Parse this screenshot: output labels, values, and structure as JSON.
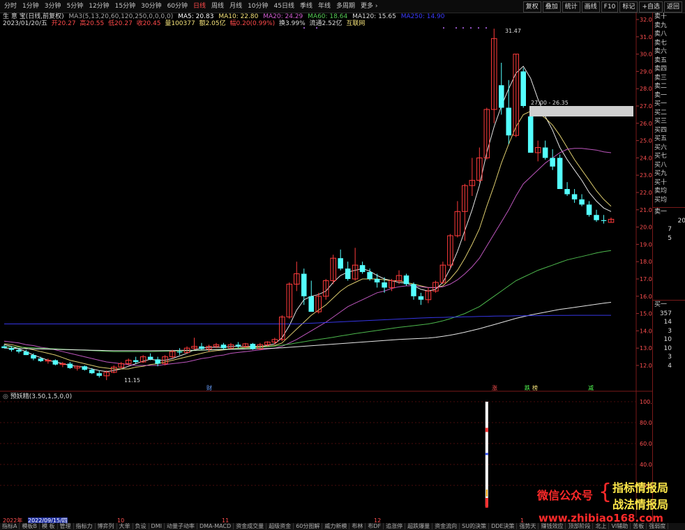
{
  "toolbar": {
    "periods": [
      "分时",
      "1分钟",
      "3分钟",
      "5分钟",
      "12分钟",
      "15分钟",
      "30分钟",
      "60分钟",
      "日线",
      "周线",
      "月线",
      "10分钟",
      "45日线",
      "季线",
      "年线",
      "多周期",
      "更多 ›"
    ],
    "active_period": "日线",
    "right_buttons": [
      "复权",
      "叠加",
      "统计",
      "画线",
      "F10",
      "标记",
      "+自选",
      "返回"
    ]
  },
  "info": {
    "line1_name": "生 意 宝(日线,前复权)",
    "line1_ma_params": "MA3(5,13,20,60,120,250,0,0,0,0)",
    "ma5": "MA5: 20.83",
    "ma10": "MA10: 22.80",
    "ma20": "MA20: 24.29",
    "ma60": "MA60: 18.64",
    "ma120": "MA120: 15.65",
    "ma250": "MA250: 14.90",
    "line2_date": "2023/01/20/五",
    "open": "开20.27",
    "high": "高20.55",
    "low": "低20.27",
    "close": "收20.45",
    "volume": "量100377",
    "amount": "额2.05亿",
    "change": "幅0.20(0.99%)",
    "turnover": "换3.99%",
    "float": "流通2.52亿",
    "sector": "互联网"
  },
  "price_axis": {
    "ticks": [
      "32.00",
      "31.00",
      "30.00",
      "29.00",
      "28.00",
      "27.00",
      "26.00",
      "25.00",
      "24.00",
      "23.00",
      "22.00",
      "21.00",
      "20.00",
      "19.00",
      "18.00",
      "17.00",
      "16.00",
      "15.00",
      "14.00",
      "13.00",
      "12.00"
    ]
  },
  "annotations": {
    "high_label": "31.47",
    "low_label": "11.15",
    "zone_label": "27.00 - 26.35",
    "event_markers": [
      "财",
      "涨",
      "跌",
      "榜",
      "减"
    ]
  },
  "sub_indicator": {
    "title": "预妖精(3.50,1,5,0,0)",
    "ticks": [
      "100.0",
      "80.00",
      "60.00",
      "40.00",
      "20.00"
    ]
  },
  "date_axis": {
    "labels": [
      "2022年",
      "2022/09/15/四",
      "10",
      "11",
      "12",
      "1"
    ]
  },
  "right_panel": {
    "sell_labels": [
      "卖十",
      "卖九",
      "卖八",
      "卖七",
      "卖六",
      "卖五",
      "卖四",
      "卖三",
      "卖二",
      "卖一"
    ],
    "buy_labels": [
      "买一",
      "买二",
      "买三",
      "买四",
      "买五",
      "买六",
      "买七",
      "买八",
      "买九",
      "买十"
    ],
    "avg_labels": [
      "卖均",
      "买均"
    ],
    "sell1_label": "卖一",
    "sell1_values": [
      "20",
      "7",
      "5"
    ],
    "buy1_label": "买一",
    "buy1_values": [
      "357",
      "14",
      "3",
      "10",
      "10",
      "3",
      "4"
    ],
    "buy1_side": "7"
  },
  "bottom_tabs": [
    "指标A",
    "模板B",
    "模 板",
    "管理",
    "指标力",
    "博弈列",
    "大单",
    "负设",
    "DMI",
    "动量子动率",
    "DMA-MACD",
    "资金成交量",
    "超级资金",
    "60分图解",
    "威力新模",
    "布林",
    "布DF",
    "追涨停",
    "超跌爆量",
    "资金流向",
    "SU的決策",
    "DDE決策",
    "强势天",
    "赚钱效应",
    "顶部阶段",
    "北上",
    "VI辅助",
    "苦板",
    "强弱度"
  ],
  "watermark": {
    "left": "微信公众号",
    "right1": "指标情报局",
    "right2": "战法情报局",
    "url": "www.zhibiao168.com"
  },
  "colors": {
    "up": "#ff3b3b",
    "down": "#54ffff",
    "ma5": "#ffffff",
    "ma10": "#f5e27a",
    "ma20": "#d35fd3",
    "ma60": "#55cc55",
    "ma120": "#ffffff",
    "ma250": "#3c3cff"
  },
  "chart_data": {
    "type": "candlestick",
    "y_range": [
      11.0,
      32.2
    ],
    "candles": [
      {
        "o": 13.1,
        "h": 13.2,
        "l": 13.0,
        "c": 13.0
      },
      {
        "o": 13.0,
        "h": 13.1,
        "l": 12.8,
        "c": 12.9
      },
      {
        "o": 12.9,
        "h": 13.0,
        "l": 12.7,
        "c": 12.8
      },
      {
        "o": 12.8,
        "h": 12.9,
        "l": 12.6,
        "c": 12.6
      },
      {
        "o": 12.6,
        "h": 12.7,
        "l": 12.3,
        "c": 12.4
      },
      {
        "o": 12.4,
        "h": 12.5,
        "l": 12.2,
        "c": 12.25
      },
      {
        "o": 12.25,
        "h": 12.4,
        "l": 12.1,
        "c": 12.3
      },
      {
        "o": 12.3,
        "h": 12.35,
        "l": 12.0,
        "c": 12.05
      },
      {
        "o": 12.05,
        "h": 12.2,
        "l": 11.9,
        "c": 12.1
      },
      {
        "o": 12.1,
        "h": 12.2,
        "l": 11.8,
        "c": 11.85
      },
      {
        "o": 11.85,
        "h": 12.0,
        "l": 11.7,
        "c": 11.95
      },
      {
        "o": 11.95,
        "h": 12.0,
        "l": 11.7,
        "c": 11.75
      },
      {
        "o": 11.75,
        "h": 11.85,
        "l": 11.5,
        "c": 11.55
      },
      {
        "o": 11.55,
        "h": 11.7,
        "l": 11.3,
        "c": 11.4
      },
      {
        "o": 11.4,
        "h": 11.7,
        "l": 11.15,
        "c": 11.6
      },
      {
        "o": 11.6,
        "h": 12.0,
        "l": 11.55,
        "c": 11.9
      },
      {
        "o": 11.9,
        "h": 12.2,
        "l": 11.8,
        "c": 12.1
      },
      {
        "o": 12.1,
        "h": 12.4,
        "l": 12.0,
        "c": 12.3
      },
      {
        "o": 12.3,
        "h": 12.5,
        "l": 12.1,
        "c": 12.2
      },
      {
        "o": 12.2,
        "h": 12.6,
        "l": 12.15,
        "c": 12.5
      },
      {
        "o": 12.5,
        "h": 12.7,
        "l": 12.3,
        "c": 12.35
      },
      {
        "o": 12.35,
        "h": 12.5,
        "l": 11.95,
        "c": 12.1
      },
      {
        "o": 12.1,
        "h": 12.6,
        "l": 12.0,
        "c": 12.5
      },
      {
        "o": 12.5,
        "h": 12.9,
        "l": 12.4,
        "c": 12.8
      },
      {
        "o": 12.8,
        "h": 13.0,
        "l": 12.6,
        "c": 12.75
      },
      {
        "o": 12.75,
        "h": 13.1,
        "l": 12.7,
        "c": 13.0
      },
      {
        "o": 13.0,
        "h": 13.6,
        "l": 12.9,
        "c": 13.1
      },
      {
        "o": 13.1,
        "h": 13.3,
        "l": 12.9,
        "c": 12.95
      },
      {
        "o": 12.95,
        "h": 13.2,
        "l": 12.8,
        "c": 13.1
      },
      {
        "o": 13.1,
        "h": 13.3,
        "l": 13.0,
        "c": 13.2
      },
      {
        "o": 13.2,
        "h": 13.3,
        "l": 12.9,
        "c": 13.0
      },
      {
        "o": 13.0,
        "h": 13.3,
        "l": 12.95,
        "c": 13.2
      },
      {
        "o": 13.2,
        "h": 13.35,
        "l": 13.0,
        "c": 13.1
      },
      {
        "o": 13.1,
        "h": 13.3,
        "l": 13.0,
        "c": 13.25
      },
      {
        "o": 13.25,
        "h": 13.3,
        "l": 12.9,
        "c": 12.95
      },
      {
        "o": 12.95,
        "h": 13.3,
        "l": 12.9,
        "c": 13.2
      },
      {
        "o": 13.2,
        "h": 13.4,
        "l": 13.1,
        "c": 13.35
      },
      {
        "o": 13.35,
        "h": 13.6,
        "l": 13.2,
        "c": 13.5
      },
      {
        "o": 13.5,
        "h": 14.9,
        "l": 13.4,
        "c": 14.8
      },
      {
        "o": 14.8,
        "h": 16.8,
        "l": 14.7,
        "c": 16.7
      },
      {
        "o": 16.7,
        "h": 18.0,
        "l": 16.3,
        "c": 17.3
      },
      {
        "o": 17.3,
        "h": 17.6,
        "l": 15.5,
        "c": 16.0
      },
      {
        "o": 16.0,
        "h": 16.9,
        "l": 15.7,
        "c": 15.1
      },
      {
        "o": 15.1,
        "h": 16.2,
        "l": 15.0,
        "c": 16.0
      },
      {
        "o": 16.0,
        "h": 17.0,
        "l": 15.8,
        "c": 16.9
      },
      {
        "o": 16.9,
        "h": 18.4,
        "l": 16.7,
        "c": 18.2
      },
      {
        "o": 18.2,
        "h": 18.7,
        "l": 17.5,
        "c": 17.6
      },
      {
        "o": 17.6,
        "h": 18.0,
        "l": 16.9,
        "c": 17.0
      },
      {
        "o": 17.0,
        "h": 18.8,
        "l": 16.9,
        "c": 17.8
      },
      {
        "o": 17.8,
        "h": 18.0,
        "l": 17.3,
        "c": 17.4
      },
      {
        "o": 17.4,
        "h": 17.6,
        "l": 16.9,
        "c": 17.0
      },
      {
        "o": 17.0,
        "h": 17.3,
        "l": 16.5,
        "c": 16.8
      },
      {
        "o": 16.8,
        "h": 17.1,
        "l": 16.2,
        "c": 16.5
      },
      {
        "o": 16.5,
        "h": 17.0,
        "l": 16.3,
        "c": 16.9
      },
      {
        "o": 16.9,
        "h": 17.5,
        "l": 16.7,
        "c": 17.2
      },
      {
        "o": 17.2,
        "h": 17.3,
        "l": 16.6,
        "c": 16.7
      },
      {
        "o": 16.7,
        "h": 16.8,
        "l": 15.8,
        "c": 16.0
      },
      {
        "o": 16.0,
        "h": 16.2,
        "l": 15.5,
        "c": 15.8
      },
      {
        "o": 15.8,
        "h": 16.5,
        "l": 15.6,
        "c": 16.3
      },
      {
        "o": 16.3,
        "h": 16.9,
        "l": 16.2,
        "c": 16.8
      },
      {
        "o": 16.8,
        "h": 18.0,
        "l": 16.7,
        "c": 17.8
      },
      {
        "o": 17.8,
        "h": 19.6,
        "l": 17.6,
        "c": 19.5
      },
      {
        "o": 19.5,
        "h": 21.5,
        "l": 19.4,
        "c": 20.9
      },
      {
        "o": 20.9,
        "h": 22.5,
        "l": 19.2,
        "c": 22.4
      },
      {
        "o": 22.4,
        "h": 24.0,
        "l": 21.8,
        "c": 22.7
      },
      {
        "o": 22.7,
        "h": 24.6,
        "l": 22.6,
        "c": 24.0
      },
      {
        "o": 24.0,
        "h": 26.9,
        "l": 23.9,
        "c": 26.8
      },
      {
        "o": 26.8,
        "h": 31.47,
        "l": 26.0,
        "c": 30.9
      },
      {
        "o": 28.2,
        "h": 29.5,
        "l": 26.5,
        "c": 26.9
      },
      {
        "o": 26.9,
        "h": 28.5,
        "l": 24.8,
        "c": 25.3
      },
      {
        "o": 25.3,
        "h": 30.0,
        "l": 25.2,
        "c": 30.0
      },
      {
        "o": 29.0,
        "h": 29.2,
        "l": 26.9,
        "c": 27.0
      },
      {
        "o": 26.4,
        "h": 26.6,
        "l": 24.3,
        "c": 24.3
      },
      {
        "o": 24.3,
        "h": 25.0,
        "l": 23.8,
        "c": 24.6
      },
      {
        "o": 24.6,
        "h": 25.0,
        "l": 23.9,
        "c": 24.0
      },
      {
        "o": 24.0,
        "h": 24.5,
        "l": 23.3,
        "c": 23.5
      },
      {
        "o": 24.0,
        "h": 24.2,
        "l": 22.2,
        "c": 22.2
      },
      {
        "o": 22.2,
        "h": 22.6,
        "l": 21.8,
        "c": 21.9
      },
      {
        "o": 21.9,
        "h": 22.2,
        "l": 21.4,
        "c": 21.6
      },
      {
        "o": 21.6,
        "h": 21.9,
        "l": 21.2,
        "c": 21.3
      },
      {
        "o": 21.3,
        "h": 21.5,
        "l": 20.6,
        "c": 20.7
      },
      {
        "o": 20.7,
        "h": 21.0,
        "l": 20.3,
        "c": 20.4
      },
      {
        "o": 20.4,
        "h": 20.7,
        "l": 20.2,
        "c": 20.35
      },
      {
        "o": 20.27,
        "h": 20.55,
        "l": 20.27,
        "c": 20.45
      }
    ],
    "ma_series": [
      {
        "name": "MA5",
        "values": [
          13.2,
          13.1,
          12.95,
          12.8,
          12.6,
          12.45,
          12.3,
          12.2,
          12.1,
          12.0,
          11.95,
          11.9,
          11.8,
          11.7,
          11.65,
          11.7,
          11.8,
          11.95,
          12.1,
          12.25,
          12.35,
          12.3,
          12.3,
          12.4,
          12.55,
          12.7,
          12.9,
          13.0,
          13.05,
          13.05,
          13.05,
          13.1,
          13.1,
          13.1,
          13.1,
          13.1,
          13.15,
          13.25,
          13.6,
          14.3,
          15.2,
          15.8,
          16.0,
          16.1,
          16.3,
          16.8,
          17.2,
          17.4,
          17.5,
          17.6,
          17.45,
          17.2,
          17.0,
          16.9,
          16.8,
          16.75,
          16.6,
          16.4,
          16.3,
          16.4,
          16.8,
          17.6,
          18.6,
          19.8,
          21.0,
          22.4,
          24.3,
          25.8,
          27.0,
          28.0,
          28.9,
          29.3,
          28.6,
          27.4,
          26.4,
          25.6,
          24.6,
          23.9,
          23.3,
          22.7,
          22.0,
          21.5,
          21.1,
          20.9
        ]
      },
      {
        "name": "MA10",
        "values": [
          13.25,
          13.2,
          13.1,
          13.0,
          12.9,
          12.8,
          12.7,
          12.6,
          12.45,
          12.3,
          12.2,
          12.1,
          12.0,
          11.9,
          11.85,
          11.8,
          11.8,
          11.8,
          11.9,
          11.95,
          12.05,
          12.1,
          12.2,
          12.3,
          12.4,
          12.5,
          12.6,
          12.7,
          12.8,
          12.85,
          12.9,
          12.95,
          13.0,
          13.05,
          13.05,
          13.1,
          13.1,
          13.15,
          13.3,
          13.7,
          14.1,
          14.5,
          14.9,
          15.2,
          15.5,
          15.9,
          16.3,
          16.6,
          16.8,
          17.0,
          17.0,
          17.0,
          16.95,
          16.9,
          16.9,
          16.8,
          16.7,
          16.6,
          16.5,
          16.5,
          16.6,
          17.0,
          17.5,
          18.2,
          19.0,
          19.9,
          21.2,
          22.4,
          23.7,
          24.8,
          25.8,
          26.5,
          26.7,
          26.6,
          26.3,
          25.9,
          25.3,
          24.6,
          23.9,
          23.3,
          22.7,
          22.1,
          21.6,
          21.2
        ]
      },
      {
        "name": "MA20",
        "values": [
          13.4,
          13.35,
          13.3,
          13.2,
          13.15,
          13.05,
          13.0,
          12.9,
          12.8,
          12.7,
          12.6,
          12.5,
          12.4,
          12.3,
          12.2,
          12.15,
          12.1,
          12.05,
          12.0,
          12.0,
          12.0,
          12.0,
          12.05,
          12.1,
          12.15,
          12.2,
          12.3,
          12.4,
          12.45,
          12.55,
          12.6,
          12.7,
          12.75,
          12.8,
          12.85,
          12.9,
          12.95,
          13.0,
          13.1,
          13.3,
          13.5,
          13.75,
          14.0,
          14.25,
          14.5,
          14.8,
          15.1,
          15.4,
          15.6,
          15.8,
          16.0,
          16.2,
          16.3,
          16.45,
          16.55,
          16.6,
          16.6,
          16.55,
          16.5,
          16.5,
          16.55,
          16.7,
          16.95,
          17.3,
          17.7,
          18.2,
          18.9,
          19.6,
          20.3,
          21.0,
          21.8,
          22.5,
          22.9,
          23.3,
          23.7,
          24.0,
          24.3,
          24.5,
          24.55,
          24.55,
          24.5,
          24.45,
          24.35,
          24.3
        ]
      },
      {
        "name": "MA60",
        "values": [
          13.1,
          13.08,
          13.06,
          13.04,
          13.02,
          13.0,
          12.98,
          12.96,
          12.94,
          12.92,
          12.9,
          12.88,
          12.86,
          12.84,
          12.82,
          12.8,
          12.8,
          12.8,
          12.8,
          12.8,
          12.8,
          12.81,
          12.82,
          12.83,
          12.84,
          12.85,
          12.86,
          12.88,
          12.9,
          12.92,
          12.94,
          12.96,
          12.98,
          13.0,
          13.02,
          13.05,
          13.08,
          13.12,
          13.17,
          13.23,
          13.3,
          13.37,
          13.44,
          13.5,
          13.56,
          13.63,
          13.7,
          13.77,
          13.84,
          13.9,
          13.96,
          14.02,
          14.08,
          14.14,
          14.2,
          14.25,
          14.3,
          14.35,
          14.4,
          14.48,
          14.58,
          14.7,
          14.85,
          15.0,
          15.2,
          15.4,
          15.7,
          16.0,
          16.3,
          16.6,
          16.9,
          17.1,
          17.3,
          17.5,
          17.65,
          17.8,
          17.95,
          18.1,
          18.2,
          18.3,
          18.4,
          18.5,
          18.58,
          18.64
        ]
      },
      {
        "name": "MA120",
        "values": [
          13.0,
          12.99,
          12.98,
          12.97,
          12.96,
          12.95,
          12.94,
          12.93,
          12.92,
          12.91,
          12.9,
          12.89,
          12.88,
          12.87,
          12.86,
          12.85,
          12.85,
          12.85,
          12.85,
          12.85,
          12.85,
          12.85,
          12.86,
          12.86,
          12.87,
          12.87,
          12.88,
          12.89,
          12.9,
          12.91,
          12.92,
          12.93,
          12.94,
          12.95,
          12.96,
          12.97,
          12.98,
          13.0,
          13.02,
          13.05,
          13.08,
          13.11,
          13.14,
          13.17,
          13.2,
          13.23,
          13.26,
          13.29,
          13.32,
          13.35,
          13.38,
          13.41,
          13.44,
          13.47,
          13.5,
          13.52,
          13.54,
          13.56,
          13.58,
          13.62,
          13.68,
          13.75,
          13.83,
          13.92,
          14.02,
          14.12,
          14.24,
          14.36,
          14.48,
          14.6,
          14.72,
          14.82,
          14.92,
          15.0,
          15.08,
          15.16,
          15.24,
          15.3,
          15.36,
          15.42,
          15.48,
          15.54,
          15.6,
          15.65
        ]
      },
      {
        "name": "MA250",
        "values": [
          14.4,
          14.4,
          14.4,
          14.4,
          14.4,
          14.4,
          14.4,
          14.4,
          14.4,
          14.4,
          14.4,
          14.4,
          14.4,
          14.4,
          14.4,
          14.4,
          14.4,
          14.4,
          14.4,
          14.4,
          14.4,
          14.4,
          14.4,
          14.4,
          14.4,
          14.4,
          14.4,
          14.4,
          14.4,
          14.4,
          14.4,
          14.4,
          14.4,
          14.4,
          14.4,
          14.4,
          14.4,
          14.4,
          14.4,
          14.4,
          14.4,
          14.42,
          14.44,
          14.46,
          14.48,
          14.5,
          14.52,
          14.54,
          14.56,
          14.58,
          14.6,
          14.62,
          14.64,
          14.66,
          14.68,
          14.7,
          14.72,
          14.74,
          14.76,
          14.77,
          14.78,
          14.79,
          14.8,
          14.81,
          14.82,
          14.83,
          14.84,
          14.85,
          14.86,
          14.86,
          14.87,
          14.87,
          14.88,
          14.88,
          14.88,
          14.89,
          14.89,
          14.89,
          14.9,
          14.9,
          14.9,
          14.9,
          14.9,
          14.9
        ]
      }
    ],
    "sub_chart": {
      "type": "bar",
      "y_range": [
        0,
        100
      ],
      "spike_index": 66,
      "spike_value": 100
    }
  }
}
